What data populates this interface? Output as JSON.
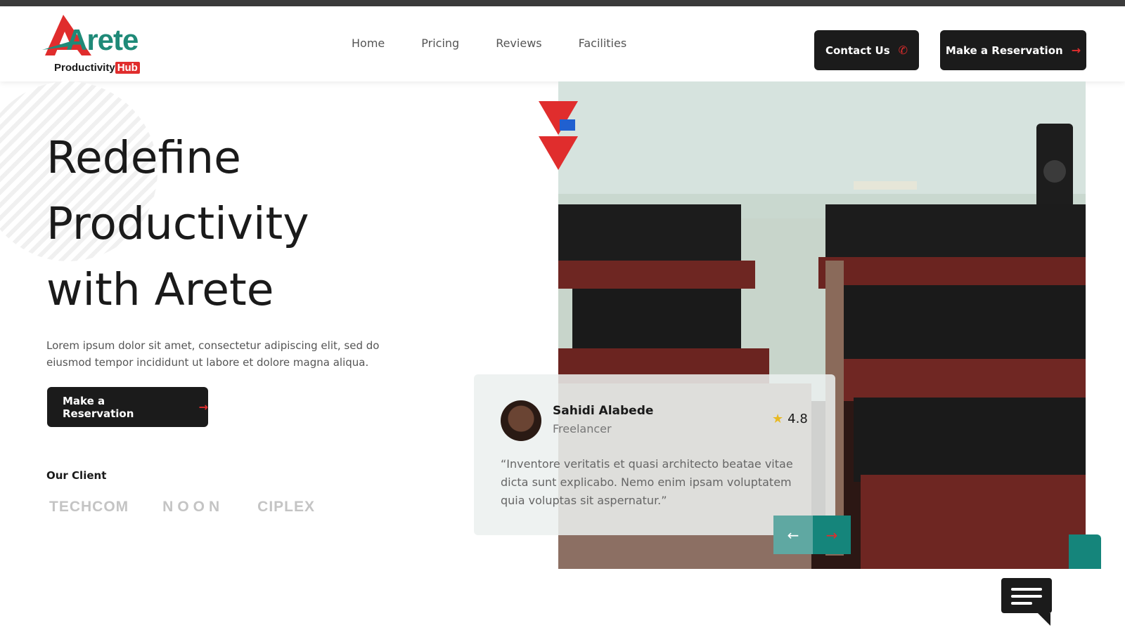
{
  "brand": {
    "name": "Arete",
    "sub": "Productivity",
    "hub": "Hub"
  },
  "nav": [
    {
      "label": "Home"
    },
    {
      "label": "Pricing"
    },
    {
      "label": "Reviews"
    },
    {
      "label": "Facilities"
    }
  ],
  "header": {
    "contact_label": "Contact Us",
    "reserve_label": "Make a Reservation"
  },
  "hero": {
    "title_lines": [
      "Redefine",
      "Productivity",
      "with Arete"
    ],
    "description": "Lorem ipsum dolor sit amet, consectetur adipiscing elit, sed do eiusmod tempor incididunt ut labore et dolore magna aliqua.",
    "cta_label": "Make a Reservation"
  },
  "clients": {
    "label": "Our Client",
    "logos": [
      "TECHCOM",
      "NOON",
      "CIPLEX"
    ]
  },
  "review": {
    "name": "Sahidi Alabede",
    "role": "Freelancer",
    "rating": "4.8",
    "quote": "“Inventore veritatis et quasi architecto beatae vitae dicta sunt explicabo. Nemo enim ipsam voluptatem quia voluptas sit aspernatur.”"
  },
  "colors": {
    "teal": "#15857b",
    "teal_light": "#5fa8a2",
    "red": "#e02d2d",
    "dark": "#1b1b1b",
    "star": "#e8b923"
  },
  "icons": {
    "contact": "phone-icon",
    "reserve": "arrow-right-icon",
    "prev": "arrow-left-icon",
    "next": "arrow-right-icon",
    "chat": "chat-icon",
    "rating": "star-icon"
  }
}
